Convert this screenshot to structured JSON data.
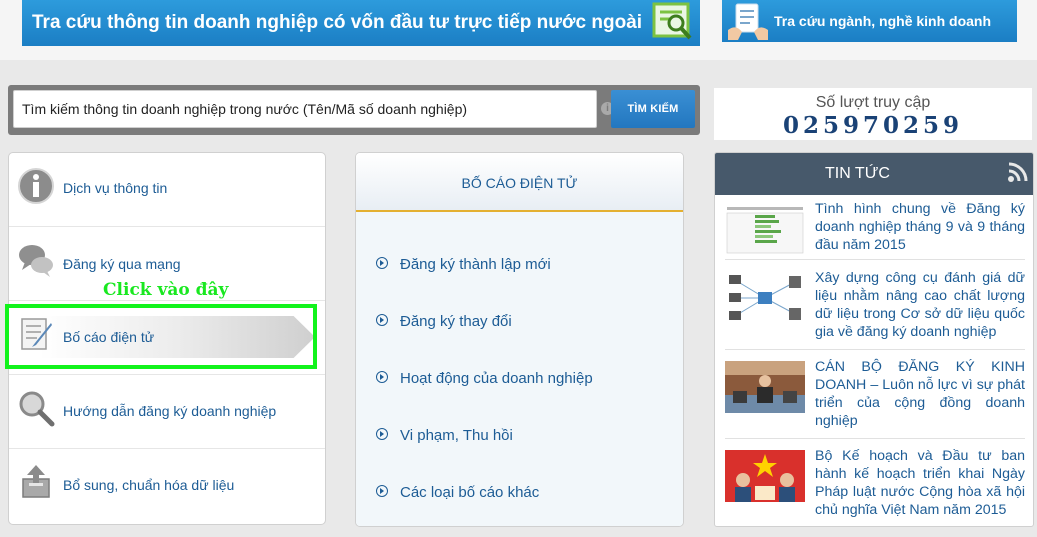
{
  "banners": {
    "fdi": "Tra cứu thông tin doanh nghiệp có vốn đầu tư trực tiếp nước ngoài",
    "nganh": "Tra cứu ngành, nghề kinh doanh"
  },
  "search": {
    "placeholder": "Tìm kiếm thông tin doanh nghiệp trong nước (Tên/Mã số doanh nghiệp)",
    "button_label": "TÌM KIẾM"
  },
  "counter": {
    "label": "Số lượt truy cập",
    "value": "025970259"
  },
  "left_menu": {
    "items": [
      {
        "label": "Dịch vụ thông tin",
        "icon": "info-icon"
      },
      {
        "label": "Đăng ký qua mạng",
        "icon": "chat-bubbles-icon"
      },
      {
        "label": "Bố cáo điện tử",
        "icon": "document-pen-icon",
        "active": true
      },
      {
        "label": "Hướng dẫn đăng ký doanh nghiệp",
        "icon": "magnifier-icon"
      },
      {
        "label": "Bổ sung, chuẩn hóa dữ liệu",
        "icon": "upload-box-icon"
      }
    ],
    "annotation": "Click vào đây",
    "annotation_color": "#12f31c"
  },
  "mid_panel": {
    "title": "BỐ CÁO ĐIỆN TỬ",
    "items": [
      "Đăng ký thành lập mới",
      "Đăng ký thay đổi",
      "Hoạt động của doanh nghiệp",
      "Vi phạm, Thu hồi",
      "Các loại bố cáo khác"
    ]
  },
  "news": {
    "title": "TIN TỨC",
    "items": [
      {
        "title": "Tình hình chung về Đăng ký doanh nghiệp tháng 9 và 9 tháng đầu năm 2015"
      },
      {
        "title": "Xây dựng công cụ đánh giá dữ liệu nhằm nâng cao chất lượng dữ liệu trong Cơ sở dữ liệu quốc gia về đăng ký doanh nghiệp"
      },
      {
        "title": "CÁN BỘ ĐĂNG KÝ KINH DOANH – Luôn nỗ lực vì sự phát triển của cộng đồng doanh nghiệp"
      },
      {
        "title": "Bộ Kế hoạch và Đầu tư ban hành kế hoạch triển khai Ngày Pháp luật nước Cộng hòa xã hội chủ nghĩa Việt Nam năm 2015"
      }
    ]
  },
  "colors": {
    "brand_blue": "#1d5c95",
    "banner_blue": "#2d9bdc",
    "accent_gold": "#e4b031",
    "news_header": "#47596b"
  }
}
